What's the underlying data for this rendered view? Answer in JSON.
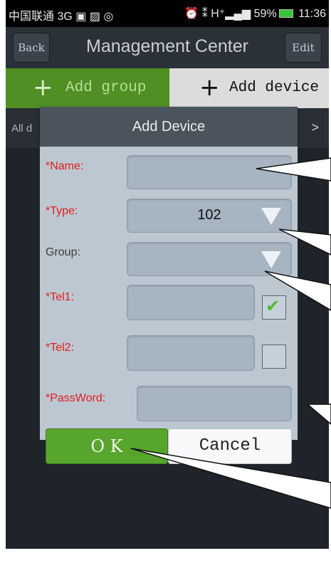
{
  "status_bar": {
    "carrier": "中国联通 3G",
    "left_icons": [
      "usb-icon",
      "image-icon",
      "app-icon"
    ],
    "right_icons": [
      "alarm-icon",
      "signal-icon"
    ],
    "network": "H⁺",
    "battery": "59%",
    "time": "11:36"
  },
  "title_bar": {
    "back_label": "Back",
    "title": "Management Center",
    "edit_label": "Edit"
  },
  "tabs": {
    "add_group": "Add group",
    "add_device": "Add device"
  },
  "sub_bar": {
    "all_label": "All d",
    "arrow": ">"
  },
  "dialog": {
    "title": "Add Device",
    "fields": {
      "name_label": "*Name:",
      "type_label": "*Type:",
      "type_value": "102",
      "group_label": "Group:",
      "group_value": "",
      "tel1_label": "*Tel1:",
      "tel1_checked": true,
      "tel2_label": "*Tel2:",
      "tel2_checked": false,
      "password_label": "*PassWord:"
    },
    "ok_label": "O K",
    "cancel_label": "Cancel"
  },
  "colors": {
    "required_label": "#e21d1d",
    "ok_button": "#58a52d",
    "add_group_tab": "#4f8f24",
    "dialog_body": "#bcc7d1",
    "dialog_header": "#4b535c"
  }
}
